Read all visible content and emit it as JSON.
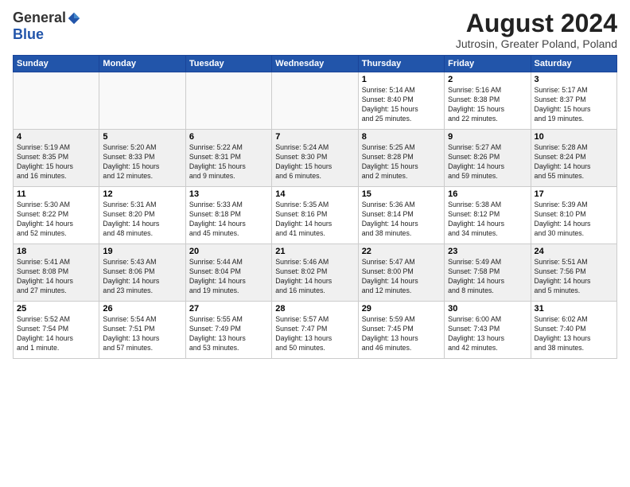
{
  "header": {
    "logo_general": "General",
    "logo_blue": "Blue",
    "title": "August 2024",
    "subtitle": "Jutrosin, Greater Poland, Poland"
  },
  "days_of_week": [
    "Sunday",
    "Monday",
    "Tuesday",
    "Wednesday",
    "Thursday",
    "Friday",
    "Saturday"
  ],
  "weeks": [
    {
      "days": [
        {
          "num": "",
          "info": ""
        },
        {
          "num": "",
          "info": ""
        },
        {
          "num": "",
          "info": ""
        },
        {
          "num": "",
          "info": ""
        },
        {
          "num": "1",
          "info": "Sunrise: 5:14 AM\nSunset: 8:40 PM\nDaylight: 15 hours\nand 25 minutes."
        },
        {
          "num": "2",
          "info": "Sunrise: 5:16 AM\nSunset: 8:38 PM\nDaylight: 15 hours\nand 22 minutes."
        },
        {
          "num": "3",
          "info": "Sunrise: 5:17 AM\nSunset: 8:37 PM\nDaylight: 15 hours\nand 19 minutes."
        }
      ]
    },
    {
      "days": [
        {
          "num": "4",
          "info": "Sunrise: 5:19 AM\nSunset: 8:35 PM\nDaylight: 15 hours\nand 16 minutes."
        },
        {
          "num": "5",
          "info": "Sunrise: 5:20 AM\nSunset: 8:33 PM\nDaylight: 15 hours\nand 12 minutes."
        },
        {
          "num": "6",
          "info": "Sunrise: 5:22 AM\nSunset: 8:31 PM\nDaylight: 15 hours\nand 9 minutes."
        },
        {
          "num": "7",
          "info": "Sunrise: 5:24 AM\nSunset: 8:30 PM\nDaylight: 15 hours\nand 6 minutes."
        },
        {
          "num": "8",
          "info": "Sunrise: 5:25 AM\nSunset: 8:28 PM\nDaylight: 15 hours\nand 2 minutes."
        },
        {
          "num": "9",
          "info": "Sunrise: 5:27 AM\nSunset: 8:26 PM\nDaylight: 14 hours\nand 59 minutes."
        },
        {
          "num": "10",
          "info": "Sunrise: 5:28 AM\nSunset: 8:24 PM\nDaylight: 14 hours\nand 55 minutes."
        }
      ]
    },
    {
      "days": [
        {
          "num": "11",
          "info": "Sunrise: 5:30 AM\nSunset: 8:22 PM\nDaylight: 14 hours\nand 52 minutes."
        },
        {
          "num": "12",
          "info": "Sunrise: 5:31 AM\nSunset: 8:20 PM\nDaylight: 14 hours\nand 48 minutes."
        },
        {
          "num": "13",
          "info": "Sunrise: 5:33 AM\nSunset: 8:18 PM\nDaylight: 14 hours\nand 45 minutes."
        },
        {
          "num": "14",
          "info": "Sunrise: 5:35 AM\nSunset: 8:16 PM\nDaylight: 14 hours\nand 41 minutes."
        },
        {
          "num": "15",
          "info": "Sunrise: 5:36 AM\nSunset: 8:14 PM\nDaylight: 14 hours\nand 38 minutes."
        },
        {
          "num": "16",
          "info": "Sunrise: 5:38 AM\nSunset: 8:12 PM\nDaylight: 14 hours\nand 34 minutes."
        },
        {
          "num": "17",
          "info": "Sunrise: 5:39 AM\nSunset: 8:10 PM\nDaylight: 14 hours\nand 30 minutes."
        }
      ]
    },
    {
      "days": [
        {
          "num": "18",
          "info": "Sunrise: 5:41 AM\nSunset: 8:08 PM\nDaylight: 14 hours\nand 27 minutes."
        },
        {
          "num": "19",
          "info": "Sunrise: 5:43 AM\nSunset: 8:06 PM\nDaylight: 14 hours\nand 23 minutes."
        },
        {
          "num": "20",
          "info": "Sunrise: 5:44 AM\nSunset: 8:04 PM\nDaylight: 14 hours\nand 19 minutes."
        },
        {
          "num": "21",
          "info": "Sunrise: 5:46 AM\nSunset: 8:02 PM\nDaylight: 14 hours\nand 16 minutes."
        },
        {
          "num": "22",
          "info": "Sunrise: 5:47 AM\nSunset: 8:00 PM\nDaylight: 14 hours\nand 12 minutes."
        },
        {
          "num": "23",
          "info": "Sunrise: 5:49 AM\nSunset: 7:58 PM\nDaylight: 14 hours\nand 8 minutes."
        },
        {
          "num": "24",
          "info": "Sunrise: 5:51 AM\nSunset: 7:56 PM\nDaylight: 14 hours\nand 5 minutes."
        }
      ]
    },
    {
      "days": [
        {
          "num": "25",
          "info": "Sunrise: 5:52 AM\nSunset: 7:54 PM\nDaylight: 14 hours\nand 1 minute."
        },
        {
          "num": "26",
          "info": "Sunrise: 5:54 AM\nSunset: 7:51 PM\nDaylight: 13 hours\nand 57 minutes."
        },
        {
          "num": "27",
          "info": "Sunrise: 5:55 AM\nSunset: 7:49 PM\nDaylight: 13 hours\nand 53 minutes."
        },
        {
          "num": "28",
          "info": "Sunrise: 5:57 AM\nSunset: 7:47 PM\nDaylight: 13 hours\nand 50 minutes."
        },
        {
          "num": "29",
          "info": "Sunrise: 5:59 AM\nSunset: 7:45 PM\nDaylight: 13 hours\nand 46 minutes."
        },
        {
          "num": "30",
          "info": "Sunrise: 6:00 AM\nSunset: 7:43 PM\nDaylight: 13 hours\nand 42 minutes."
        },
        {
          "num": "31",
          "info": "Sunrise: 6:02 AM\nSunset: 7:40 PM\nDaylight: 13 hours\nand 38 minutes."
        }
      ]
    }
  ]
}
